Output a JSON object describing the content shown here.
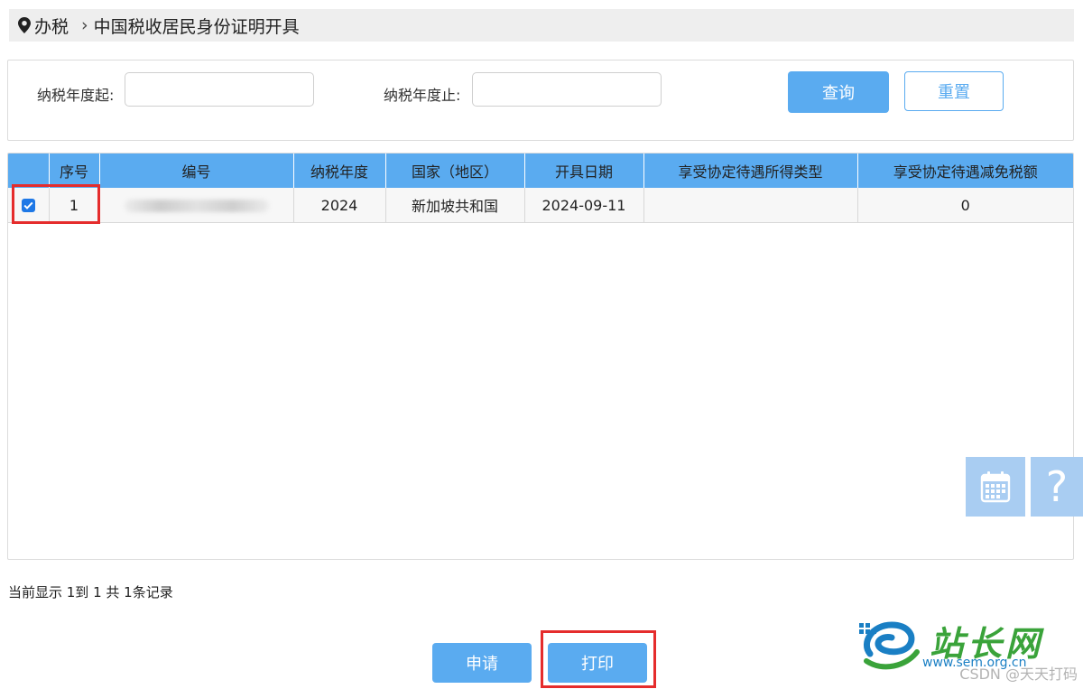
{
  "breadcrumb": {
    "root": "办税",
    "separator": "›",
    "current": "中国税收居民身份证明开具"
  },
  "query": {
    "start_label": "纳税年度起:",
    "start_value": "",
    "end_label": "纳税年度止:",
    "end_value": "",
    "search_label": "查询",
    "reset_label": "重置"
  },
  "table": {
    "columns": [
      "",
      "序号",
      "编号",
      "纳税年度",
      "国家（地区）",
      "开具日期",
      "享受协定待遇所得类型",
      "享受协定待遇减免税额"
    ],
    "rows": [
      {
        "checked": true,
        "seq": "1",
        "number": "",
        "tax_year": "2024",
        "country": "新加坡共和国",
        "issue_date": "2024-09-11",
        "income_type": "",
        "relief_amount": "0"
      }
    ]
  },
  "floating_tools": [
    {
      "icon": "calendar-icon"
    },
    {
      "icon": "help-icon",
      "glyph": "?"
    }
  ],
  "pagination": {
    "info": "当前显示 1到 1 共 1条记录"
  },
  "actions": {
    "apply_label": "申请",
    "print_label": "打印"
  },
  "brand": {
    "name": "站长网",
    "url": "www.sem.org.cn"
  },
  "watermark": "CSDN @天天打码",
  "colors": {
    "primary": "#5aabf0",
    "highlight": "#e52c2c",
    "checkbox": "#1e78e6",
    "floating": "#a9cdf2"
  }
}
